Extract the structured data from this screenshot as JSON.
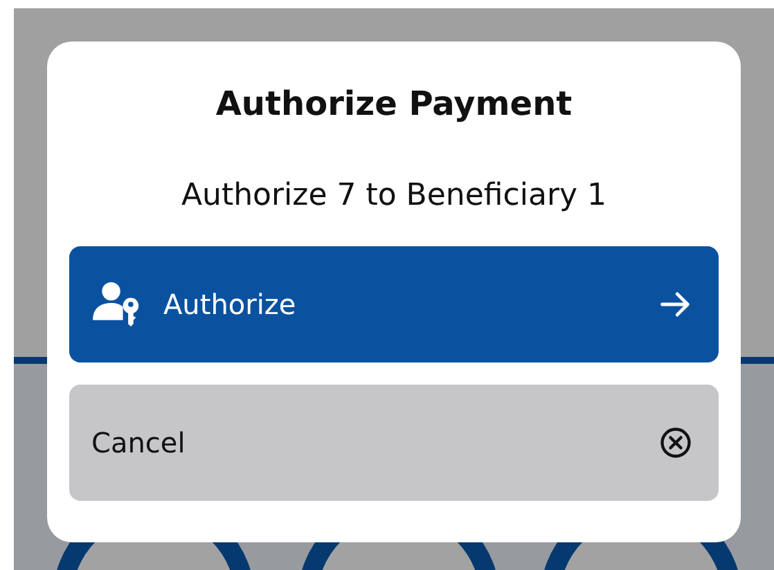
{
  "dialog": {
    "title": "Authorize Payment",
    "message": "Authorize 7 to Beneficiary 1"
  },
  "actions": [
    {
      "kind": "primary",
      "label": "Authorize"
    },
    {
      "kind": "secondary",
      "label": "Cancel"
    }
  ]
}
